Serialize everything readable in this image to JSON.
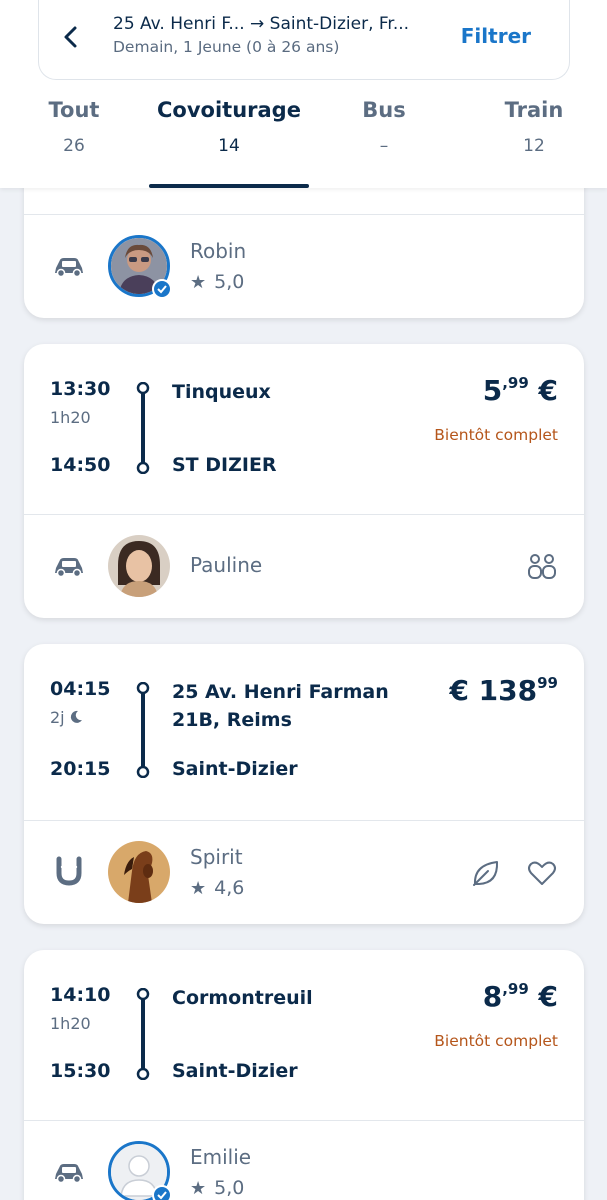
{
  "search": {
    "route": "25 Av. Henri F... → Saint-Dizier, Fr...",
    "subtitle": "Demain, 1 Jeune (0 à 26 ans)",
    "filter_label": "Filtrer"
  },
  "tabs": [
    {
      "label": "Tout",
      "count": "26"
    },
    {
      "label": "Covoiturage",
      "count": "14"
    },
    {
      "label": "Bus",
      "count": "–"
    },
    {
      "label": "Train",
      "count": "12"
    }
  ],
  "active_tab": "Covoiturage",
  "rides": [
    {
      "driver": "Robin",
      "rating": "5,0",
      "vehicle_icon": "car-icon"
    },
    {
      "departure_time": "13:30",
      "duration": "1h20",
      "arrival_time": "14:50",
      "from": "Tinqueux",
      "to": "ST DIZIER",
      "price_main": "5",
      "price_cents": ",99",
      "currency": "€",
      "status": "Bientôt complet",
      "driver": "Pauline",
      "vehicle_icon": "car-icon",
      "extra_icon": "two-passengers-icon"
    },
    {
      "departure_time": "04:15",
      "duration": "2j",
      "arrival_time": "20:15",
      "from_line1": "25 Av. Henri Farman",
      "from_line2": "21B, Reims",
      "to": "Saint-Dizier",
      "currency": "€",
      "price_main": "138",
      "price_cents": "99",
      "driver": "Spirit",
      "rating": "4,6",
      "vehicle_icon": "horseshoe-icon",
      "extra_icons": [
        "leaf-icon",
        "heart-icon"
      ]
    },
    {
      "departure_time": "14:10",
      "duration": "1h20",
      "arrival_time": "15:30",
      "from": "Cormontreuil",
      "to": "Saint-Dizier",
      "price_main": "8",
      "price_cents": ",99",
      "currency": "€",
      "status": "Bientôt complet",
      "driver": "Emilie",
      "rating": "5,0",
      "vehicle_icon": "car-icon"
    }
  ],
  "colors": {
    "primary": "#0b2a4a",
    "accent": "#1a76c9",
    "warning": "#b5561b",
    "muted": "#5c6d82",
    "background": "#eef1f6"
  }
}
